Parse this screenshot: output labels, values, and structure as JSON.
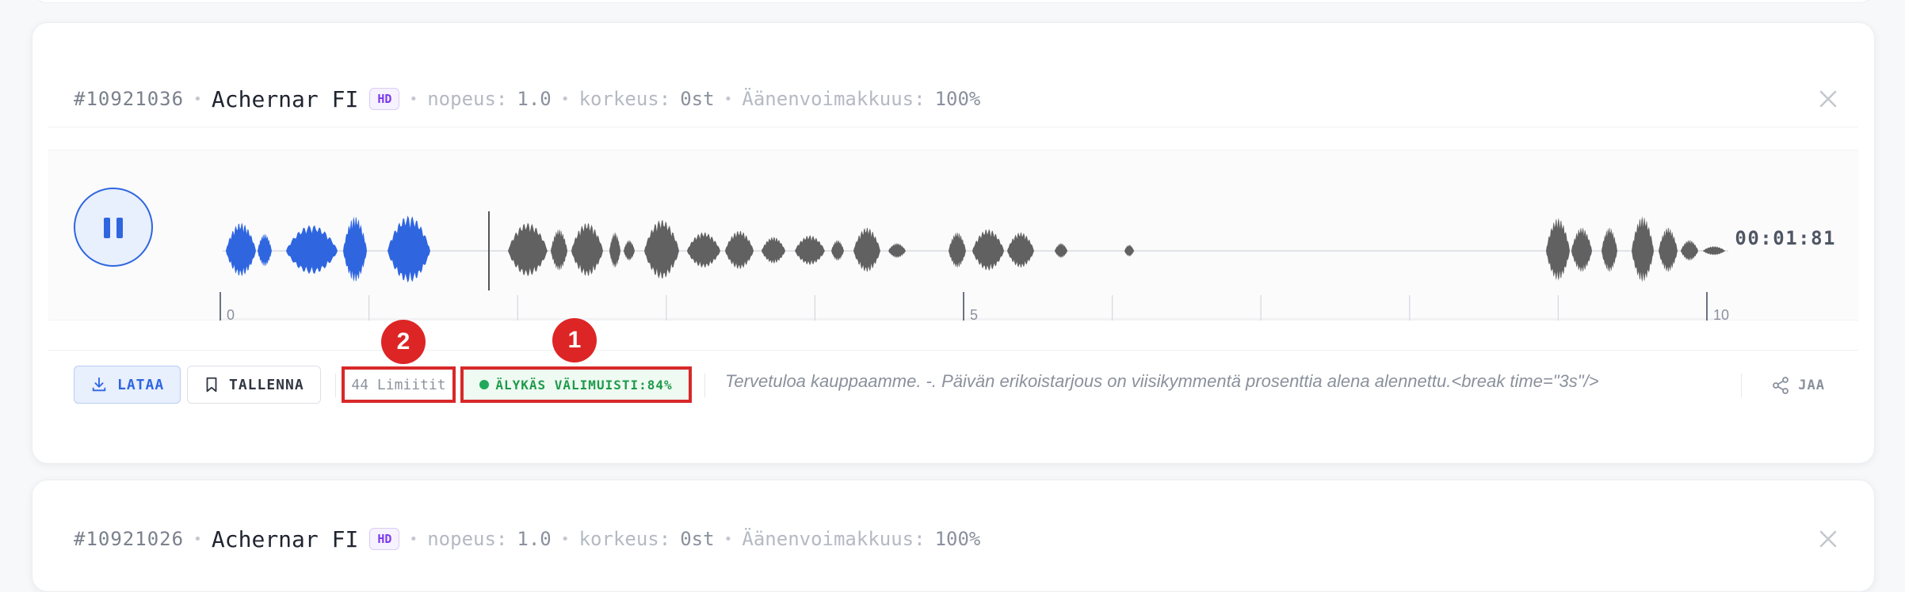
{
  "entries": [
    {
      "id": "#10921036",
      "voice_name": "Achernar FI",
      "quality_badge": "HD",
      "speed_label": "nopeus:",
      "speed_value": "1.0",
      "pitch_label": "korkeus:",
      "pitch_value": "0st",
      "volume_label": "Äänenvoimakkuus:",
      "volume_value": "100%",
      "time": "00:01:81",
      "axis_ticks": [
        "0",
        "5",
        "10"
      ],
      "download_label": "LATAA",
      "save_label": "TALLENNA",
      "credits_text": "44 Limiitit",
      "cache_label": "ÄLYKÄS VÄLIMUISTI:84%",
      "tts_text": "Tervetuloa kauppaamme. -. Päivän erikoistarjous on viisikymmentä prosenttia alena alennettu.<break time=\"3s\"/>",
      "share_label": "JAA"
    },
    {
      "id": "#10921026",
      "voice_name": "Achernar FI",
      "quality_badge": "HD",
      "speed_label": "nopeus:",
      "speed_value": "1.0",
      "pitch_label": "korkeus:",
      "pitch_value": "0st",
      "volume_label": "Äänenvoimakkuus:",
      "volume_value": "100%"
    }
  ],
  "annotations": [
    "1",
    "2"
  ],
  "colors": {
    "accent": "#2f66e0",
    "waveform_played": "#2f66e0",
    "waveform_unplayed": "#616161",
    "cache_green": "#1f9a4a",
    "highlight_red": "#d82828"
  },
  "icons": {
    "play_button": "pause-icon",
    "download": "download-icon",
    "save": "bookmark-icon",
    "share": "share-icon",
    "close": "close-icon"
  }
}
